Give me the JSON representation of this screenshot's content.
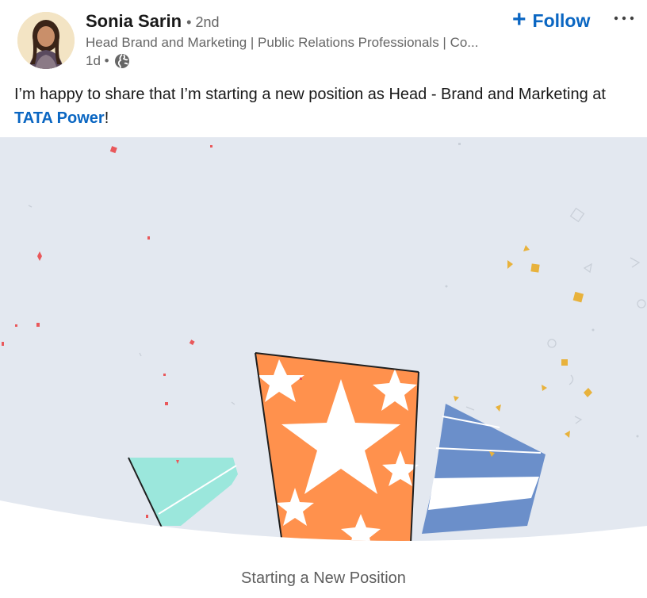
{
  "author": {
    "name": "Sonia Sarin",
    "degree": "• 2nd",
    "headline": "Head Brand and Marketing | Public Relations Professionals | Co...",
    "timestamp": "1d •",
    "visibility_icon": "globe-icon"
  },
  "actions": {
    "follow_label": "Follow",
    "follow_icon": "+",
    "more_icon": "···"
  },
  "post": {
    "text_before": "I’m happy to share that I’m starting a new position as Head - Brand and Marketing at ",
    "mention": "TATA Power",
    "text_after": "!"
  },
  "celebration": {
    "caption": "Starting a New Position",
    "colors": {
      "background": "#e3e8f0",
      "orange": "#ff914d",
      "blue": "#6b8fca",
      "mint": "#9be7dc",
      "confetti_gold": "#e8b23c",
      "confetti_red": "#e9585b"
    }
  },
  "theme": {
    "link_color": "#0a66c2",
    "secondary_text": "#666666"
  }
}
